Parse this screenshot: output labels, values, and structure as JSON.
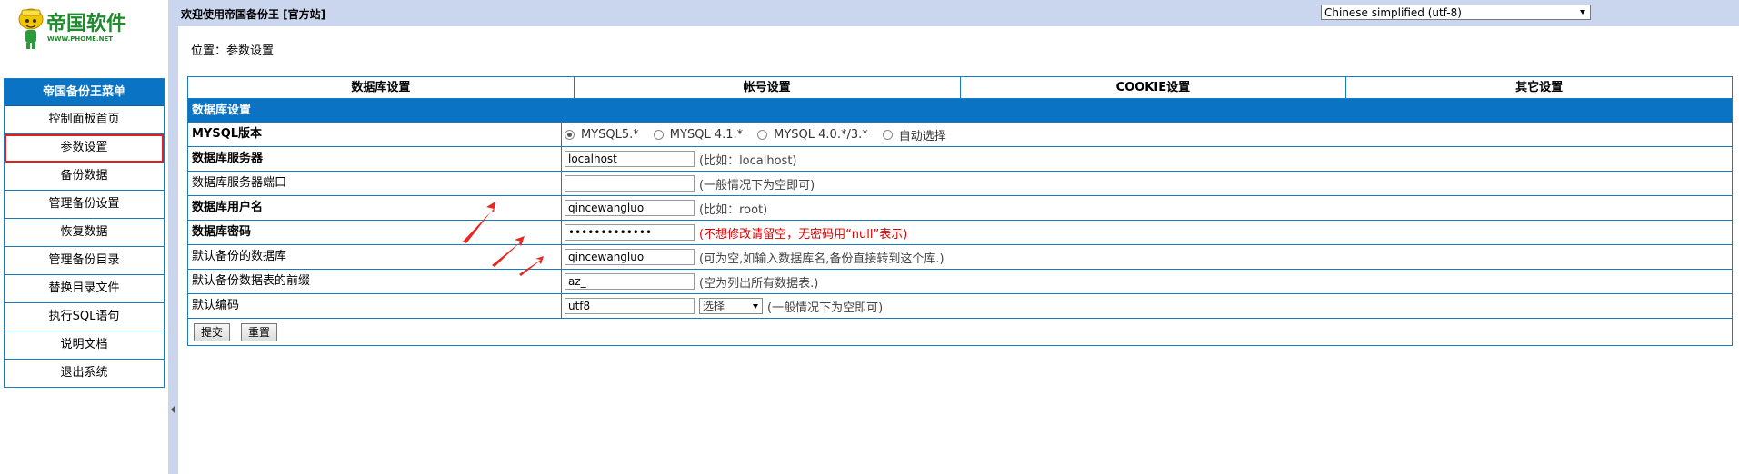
{
  "logo": {
    "brand": "帝国软件",
    "url_text": "WWW.PHOME.NET"
  },
  "sidebar": {
    "title": "帝国备份王菜单",
    "items": [
      {
        "label": "控制面板首页"
      },
      {
        "label": "参数设置"
      },
      {
        "label": "备份数据"
      },
      {
        "label": "管理备份设置"
      },
      {
        "label": "恢复数据"
      },
      {
        "label": "管理备份目录"
      },
      {
        "label": "替换目录文件"
      },
      {
        "label": "执行SQL语句"
      },
      {
        "label": "说明文档"
      },
      {
        "label": "退出系统"
      }
    ],
    "active_index": 1
  },
  "header": {
    "welcome": "欢迎使用帝国备份王 [官方站]",
    "language": "Chinese simplified (utf-8)"
  },
  "main": {
    "breadcrumb": "位置：参数设置",
    "tabs": [
      "数据库设置",
      "帐号设置",
      "COOKIE设置",
      "其它设置"
    ],
    "section_title": "数据库设置",
    "mysql_version": {
      "label": "MYSQL版本",
      "options": [
        "MYSQL5.*",
        "MYSQL 4.1.*",
        "MYSQL 4.0.*/3.*",
        "自动选择"
      ],
      "selected": 0
    },
    "db_server": {
      "label": "数据库服务器",
      "value": "localhost",
      "hint": "(比如：localhost)"
    },
    "db_port": {
      "label": "数据库服务器端口",
      "value": "",
      "hint": "(一般情况下为空即可)"
    },
    "db_user": {
      "label": "数据库用户名",
      "value": "qincewangluo",
      "hint": "(比如：root)"
    },
    "db_password": {
      "label": "数据库密码",
      "value": "•••••••••••••",
      "hint": "(不想修改请留空，无密码用“null”表示)"
    },
    "default_db": {
      "label": "默认备份的数据库",
      "value": "qincewangluo",
      "hint": "(可为空,如输入数据库名,备份直接转到这个库.)"
    },
    "table_prefix": {
      "label": "默认备份数据表的前缀",
      "value": "az_",
      "hint": "(空为列出所有数据表.)"
    },
    "charset": {
      "label": "默认编码",
      "value": "utf8",
      "select": "选择",
      "hint": "(一般情况下为空即可)"
    },
    "buttons": {
      "submit": "提交",
      "reset": "重置"
    }
  },
  "colors": {
    "accent": "#0a73c3",
    "border": "#1a7bc1",
    "topbar": "#c9d6ee",
    "warn": "#dd0000"
  }
}
